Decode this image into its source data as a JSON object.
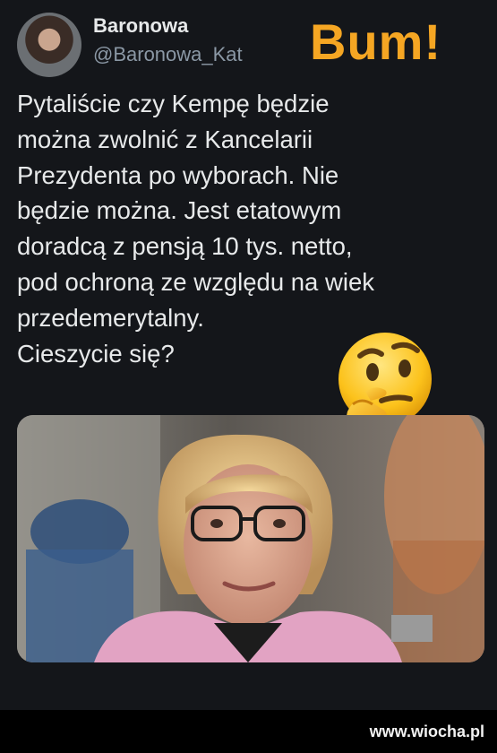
{
  "tweet": {
    "display_name": "Baronowa",
    "handle": "@Baronowa_Kat",
    "lines": [
      "Pytaliście czy Kempę będzie",
      "można zwolnić z Kancelarii",
      "Prezydenta po wyborach. Nie",
      "będzie można. Jest etatowym",
      "doradcą z pensją 10 tys. netto,",
      "pod ochroną ze względu na wiek",
      "przedemerytalny.",
      "Cieszycie się?"
    ]
  },
  "overlay": {
    "caption": "Bum!",
    "emoji": "thinking-face-icon"
  },
  "watermark": "www.wiocha.pl",
  "colors": {
    "background": "#14161a",
    "text": "#e7e9ea",
    "handle": "#8b98a5",
    "accent": "#f5a623"
  }
}
